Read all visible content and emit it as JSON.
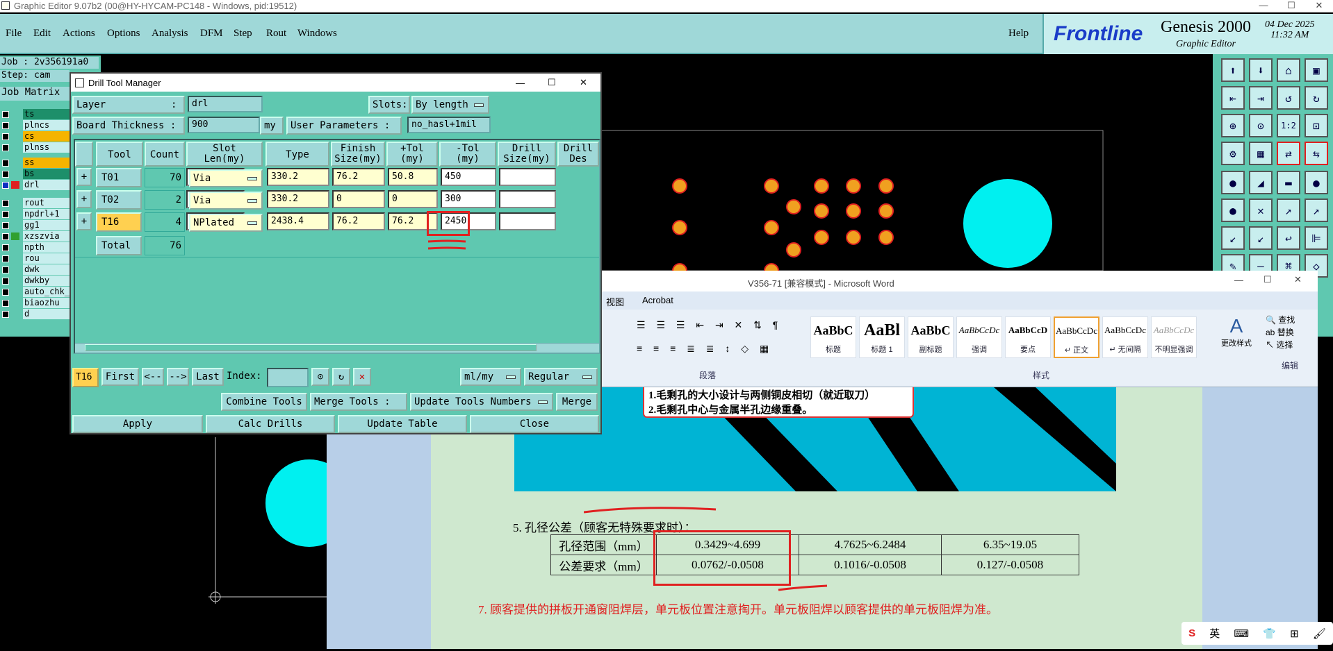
{
  "app": {
    "title": "Graphic Editor 9.07b2 (00@HY-HYCAM-PC148 - Windows, pid:19512)",
    "menu": [
      "File",
      "Edit",
      "Actions",
      "Options",
      "Analysis",
      "DFM",
      "Step",
      "Rout",
      "Windows"
    ],
    "help": "Help",
    "brand": "Frontline",
    "product": "Genesis 2000",
    "subtitle": "Graphic Editor",
    "date": "04 Dec 2025",
    "time": "11:32 AM"
  },
  "job": {
    "job_line": "Job : 2v356191a0",
    "step_line": "Step: cam",
    "matrix_label": "Job Matrix",
    "layers": [
      {
        "name": "ts",
        "color": "#1d8f6a"
      },
      {
        "name": "plncs",
        "color": "#c8eeee"
      },
      {
        "name": "cs",
        "color": "#f5b400"
      },
      {
        "name": "plnss",
        "color": "#c8eeee"
      },
      {
        "name": "ss",
        "color": "#f5b400"
      },
      {
        "name": "bs",
        "color": "#1d8f6a"
      },
      {
        "name": "drl",
        "color": "#c8eeee"
      },
      {
        "name": "rout",
        "color": "#c8eeee"
      },
      {
        "name": "npdrl+1",
        "color": "#c8eeee"
      },
      {
        "name": "gg1",
        "color": "#c8eeee"
      },
      {
        "name": "xzszvia",
        "color": "#c8eeee"
      },
      {
        "name": "npth",
        "color": "#c8eeee"
      },
      {
        "name": "rou",
        "color": "#c8eeee"
      },
      {
        "name": "dwk",
        "color": "#c8eeee"
      },
      {
        "name": "dwkby",
        "color": "#c8eeee"
      },
      {
        "name": "auto_chk_j",
        "color": "#c8eeee"
      },
      {
        "name": "biaozhu",
        "color": "#c8eeee"
      },
      {
        "name": "d",
        "color": "#c8eeee"
      }
    ]
  },
  "dialog": {
    "title": "Drill Tool Manager",
    "layer_label": "Layer",
    "layer_colon": ":",
    "layer_value": "drl",
    "slots_label": "Slots:",
    "slots_value": "By length",
    "thickness_label": "Board Thickness :",
    "thickness_value": "900",
    "thickness_unit": "my",
    "user_params_label": "User Parameters :",
    "user_params_value": "no_hasl+1mil",
    "columns": [
      "Tool",
      "Count",
      "Slot\nLen(my)",
      "Type",
      "Finish\nSize(my)",
      "+Tol\n(my)",
      "-Tol\n(my)",
      "Drill\nSize(my)",
      "Drill\nDes"
    ],
    "rows": [
      {
        "tool": "T01",
        "count": "70",
        "slot": "",
        "type": "Via",
        "finish": "330.2",
        "ptol": "76.2",
        "mtol": "50.8",
        "drill": "450",
        "des": ""
      },
      {
        "tool": "T02",
        "count": "2",
        "slot": "",
        "type": "Via",
        "finish": "330.2",
        "ptol": "0",
        "mtol": "0",
        "drill": "300",
        "des": ""
      },
      {
        "tool": "T16",
        "count": "4",
        "slot": "",
        "type": "NPlated",
        "finish": "2438.4",
        "ptol": "76.2",
        "mtol": "76.2",
        "drill": "2450",
        "des": ""
      }
    ],
    "total_label": "Total",
    "total_count": "76",
    "nav": {
      "current": "T16",
      "first": "First",
      "prev": "<--",
      "next": "-->",
      "last": "Last",
      "index_label": "Index:",
      "units": "ml/my",
      "mode": "Regular"
    },
    "actions": {
      "combine": "Combine Tools",
      "merge_label": "Merge Tools :",
      "update_numbers": "Update Tools Numbers",
      "merge": "Merge"
    },
    "bottom": {
      "apply": "Apply",
      "calc": "Calc Drills",
      "update": "Update Table",
      "close": "Close"
    }
  },
  "word": {
    "title": "V356-71 [兼容模式] - Microsoft Word",
    "tabs": [
      "视图",
      "Acrobat"
    ],
    "styles": [
      {
        "preview": "AaBbC",
        "name": "标题"
      },
      {
        "preview": "AaBl",
        "name": "标题 1"
      },
      {
        "preview": "AaBbC",
        "name": "副标题"
      },
      {
        "preview": "AaBbCcDc",
        "name": "强调"
      },
      {
        "preview": "AaBbCcD",
        "name": "要点"
      },
      {
        "preview": "AaBbCcDc",
        "name": "↵ 正文"
      },
      {
        "preview": "AaBbCcDc",
        "name": "↵ 无间隔"
      },
      {
        "preview": "AaBbCcDc",
        "name": "不明显强调"
      }
    ],
    "group_paragraph": "段落",
    "group_styles": "样式",
    "group_edit": "编辑",
    "change_styles": "更改样式",
    "edit_items": [
      "查找",
      "替换",
      "选择"
    ],
    "note_line1": "1.毛剩孔的大小设计与两侧铜皮相切（就近取刀）",
    "note_line2": "2.毛剩孔中心与金属半孔边缘重叠。",
    "section5": "5. 孔径公差（顾客无特殊要求时）：",
    "table": [
      [
        "孔径范围（mm）",
        "0.3429~4.699",
        "4.7625~6.2484",
        "6.35~19.05"
      ],
      [
        "公差要求（mm）",
        "0.0762/-0.0508",
        "0.1016/-0.0508",
        "0.127/-0.0508"
      ]
    ],
    "item7": "7. 顾客提供的拼板开通窗阻焊层，单元板位置注意掏开。单元板阻焊以顾客提供的单元板阻焊为准。"
  },
  "tray": [
    "S",
    "英",
    "⌨",
    "👕",
    "⊞",
    "🖌"
  ]
}
